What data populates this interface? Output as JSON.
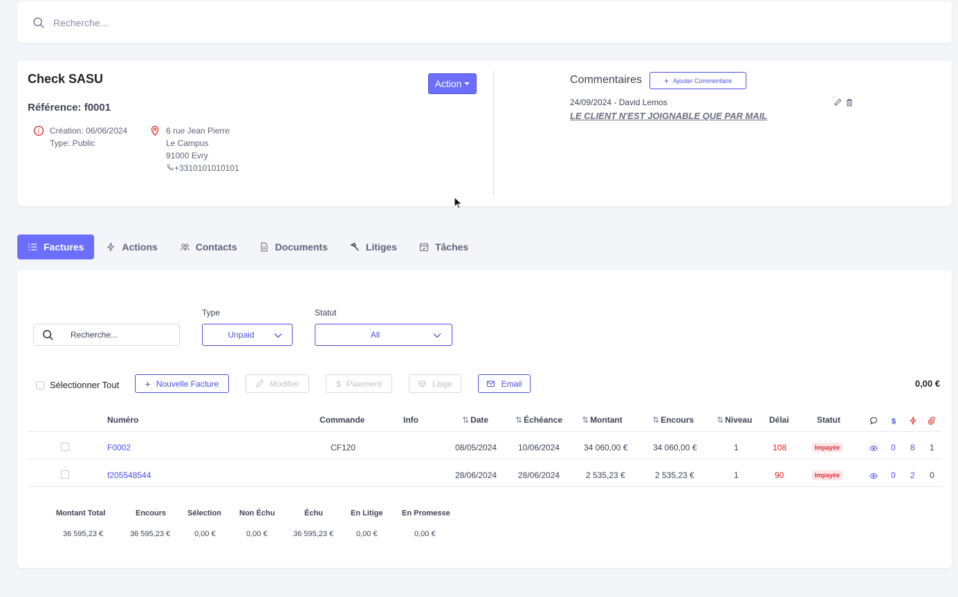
{
  "search": {
    "placeholder": "Recherche..."
  },
  "company": {
    "name": "Check SASU",
    "reference": "Référence: f0001",
    "creation": "Création: 06/06/2024",
    "type": "Type: Public",
    "address": [
      "6 rue Jean Pierre",
      "Le Campus",
      "91000 Evry"
    ],
    "phone": "+3310101010101",
    "action_label": "Action"
  },
  "comments": {
    "title": "Commentaires",
    "add_label": "Ajouter Commentaire",
    "items": [
      {
        "meta": "24/09/2024 - David Lemos",
        "text": "LE CLIENT N'EST JOIGNABLE QUE PAR MAIL"
      }
    ]
  },
  "tabs": [
    {
      "label": "Factures",
      "icon": "list-icon",
      "active": true
    },
    {
      "label": "Actions",
      "icon": "lightning-icon"
    },
    {
      "label": "Contacts",
      "icon": "people-icon"
    },
    {
      "label": "Documents",
      "icon": "document-icon"
    },
    {
      "label": "Litiges",
      "icon": "hammer-icon"
    },
    {
      "label": "Tâches",
      "icon": "calendar-icon"
    }
  ],
  "filters": {
    "search_placeholder": "Recherche...",
    "type_label": "Type",
    "type_value": "Unpaid",
    "status_label": "Statut",
    "status_value": "All"
  },
  "toolbar": {
    "select_all": "Sélectionner Tout",
    "new_invoice": "Nouvelle Facture",
    "edit": "Modifier",
    "payment": "Paiement",
    "dispute": "Litige",
    "email": "Email",
    "total": "0,00 €"
  },
  "table": {
    "headers": {
      "numero": "Numéro",
      "commande": "Commande",
      "info": "Info",
      "date": "Date",
      "echeance": "Échéance",
      "montant": "Montant",
      "encours": "Encours",
      "niveau": "Niveau",
      "delai": "Délai",
      "statut": "Statut"
    },
    "rows": [
      {
        "numero": "F0002",
        "commande": "CF120",
        "date": "08/05/2024",
        "echeance": "10/06/2024",
        "montant": "34 060,00 €",
        "encours": "34 060,00 €",
        "niveau": "1",
        "delai": "108",
        "statut": "Impayée",
        "comments": "0",
        "actions": "8",
        "attachments": "1"
      },
      {
        "numero": "f205548544",
        "commande": "",
        "date": "28/06/2024",
        "echeance": "28/06/2024",
        "montant": "2 535,23 €",
        "encours": "2 535,23 €",
        "niveau": "1",
        "delai": "90",
        "statut": "Impayée",
        "comments": "0",
        "actions": "2",
        "attachments": "0"
      }
    ]
  },
  "summary": {
    "headers": [
      "Montant Total",
      "Encours",
      "Sélection",
      "Non Échu",
      "Échu",
      "En Litige",
      "En Promesse"
    ],
    "values": [
      "36 595,23 €",
      "36 595,23 €",
      "0,00 €",
      "0,00 €",
      "36 595,23 €",
      "0,00 €",
      "0,00 €"
    ]
  },
  "colors": {
    "primary": "#6c6ffd",
    "danger": "#e02020"
  }
}
